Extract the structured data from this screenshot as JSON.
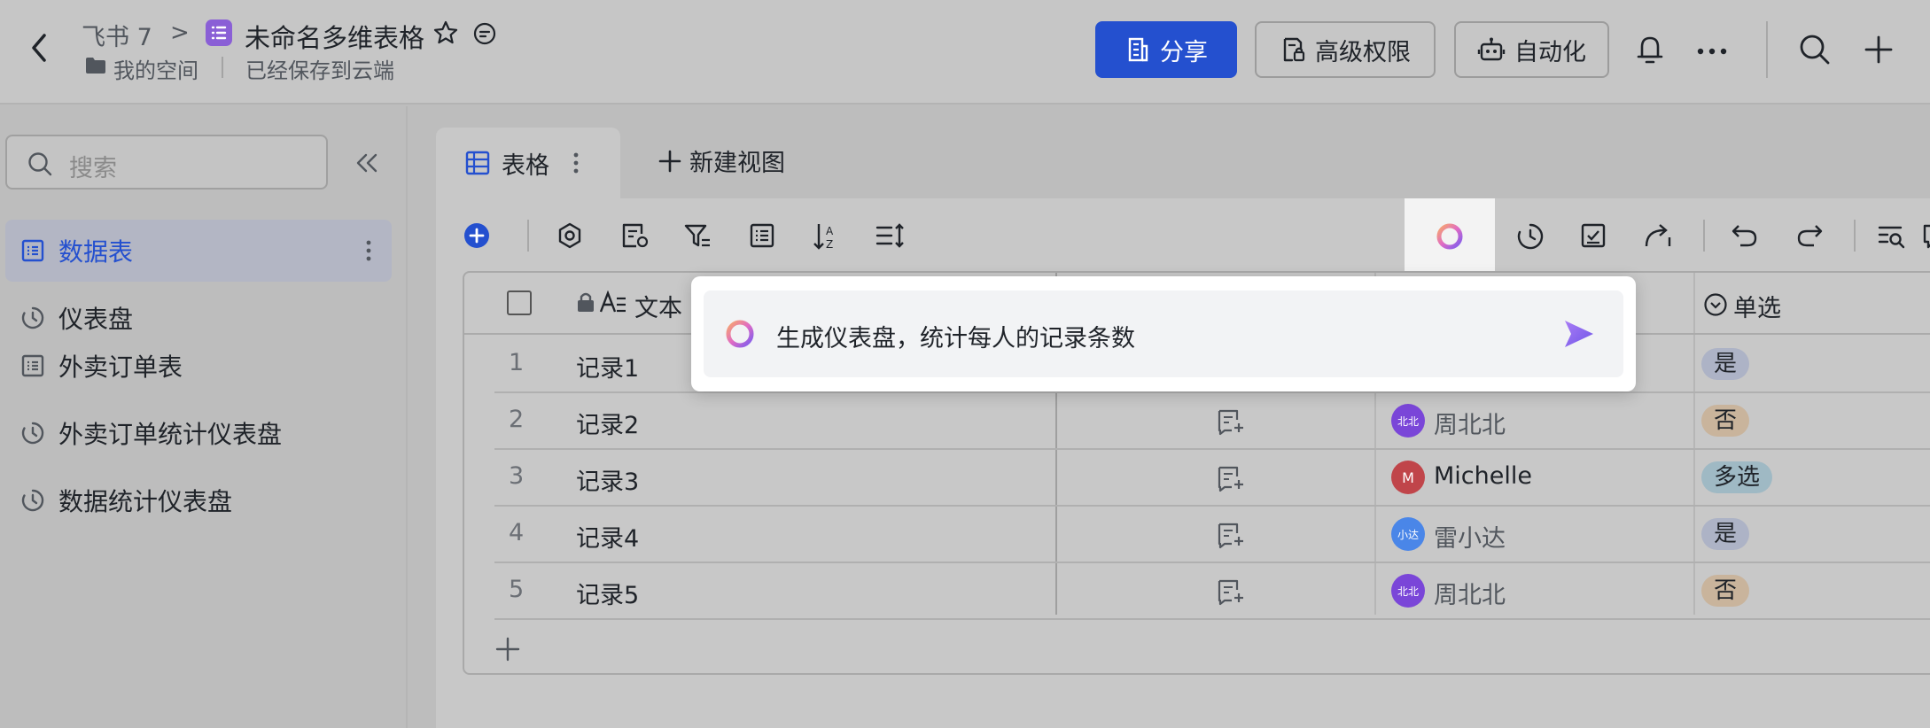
{
  "header": {
    "crumb_parent": "飞书 7",
    "crumb_sep": ">",
    "doc_title": "未命名多维表格",
    "space": "我的空间",
    "saved_status": "已经保存到云端",
    "share_label": "分享",
    "permissions_label": "高级权限",
    "automation_label": "自动化",
    "brand_color": "#2450cf"
  },
  "sidebar": {
    "search_placeholder": "搜索",
    "items": [
      {
        "label": "数据表",
        "icon": "table-icon",
        "active": true
      },
      {
        "label": "仪表盘",
        "icon": "dashboard-icon",
        "active": false
      },
      {
        "label": "外卖订单表",
        "icon": "table-icon",
        "active": false
      },
      {
        "label": "外卖订单统计仪表盘",
        "icon": "dashboard-icon",
        "active": false
      },
      {
        "label": "数据统计仪表盘",
        "icon": "dashboard-icon",
        "active": false
      }
    ]
  },
  "main": {
    "tab_label": "表格",
    "new_view_label": "新建视图"
  },
  "table": {
    "col_text": "文本",
    "col_single": "单选",
    "rows": [
      {
        "num": "1",
        "text": "记录1",
        "person": "",
        "person_avatar": "",
        "tag": "是"
      },
      {
        "num": "2",
        "text": "记录2",
        "person": "周北北",
        "person_avatar": "北北",
        "tag": "否"
      },
      {
        "num": "3",
        "text": "记录3",
        "person": "Michelle",
        "person_avatar": "M",
        "tag": "多选"
      },
      {
        "num": "4",
        "text": "记录4",
        "person": "雷小达",
        "person_avatar": "小达",
        "tag": "是"
      },
      {
        "num": "5",
        "text": "记录5",
        "person": "周北北",
        "person_avatar": "北北",
        "tag": "否"
      }
    ],
    "tag_colors": {
      "是": "#adb3c6",
      "否": "#c9b49c",
      "多选": "#9fb9c4"
    }
  },
  "ai": {
    "prompt": "生成仪表盘，统计每人的记录条数"
  }
}
